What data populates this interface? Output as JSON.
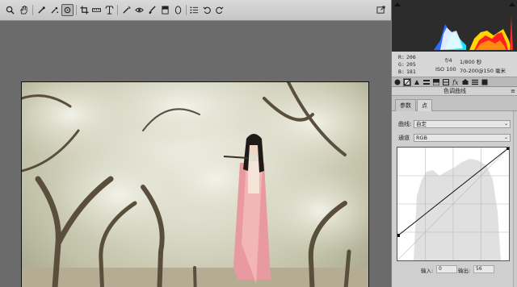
{
  "toolbar": {
    "tools": [
      {
        "name": "zoom-tool"
      },
      {
        "name": "hand-tool"
      },
      {
        "name": "white-balance-tool"
      },
      {
        "name": "color-sampler-tool"
      },
      {
        "name": "targeted-adjustment-tool"
      },
      {
        "name": "crop-tool"
      },
      {
        "name": "straighten-tool"
      },
      {
        "name": "transform-tool"
      },
      {
        "name": "spot-removal-tool"
      },
      {
        "name": "red-eye-tool"
      },
      {
        "name": "adjustment-brush-tool"
      },
      {
        "name": "graduated-filter-tool"
      },
      {
        "name": "radial-filter-tool"
      },
      {
        "name": "preferences-tool"
      },
      {
        "name": "rotate-ccw-tool"
      },
      {
        "name": "rotate-cw-tool"
      }
    ],
    "active_tool": "targeted-adjustment-tool"
  },
  "info": {
    "r_label": "R:",
    "r_value": "206",
    "g_label": "G:",
    "g_value": "205",
    "b_label": "B:",
    "b_value": "181",
    "aperture": "f/4",
    "shutter": "1/800 秒",
    "iso": "ISO 100",
    "lens": "70-200@150 毫米"
  },
  "panel": {
    "title": "色调曲线",
    "tabs": [
      {
        "label": "参数"
      },
      {
        "label": "点"
      }
    ],
    "active_tab": 1,
    "curve_label": "曲线:",
    "curve_value": "自定",
    "channel_label": "通道",
    "channel_value": "RGB",
    "input_label": "输入:",
    "input_value": "0",
    "output_label": "输出:",
    "output_value": "56"
  },
  "colors": {
    "toolbar_bg": "#cdcdcd",
    "viewport_bg": "#6b6b6b",
    "panel_bg": "#cfcfcf",
    "histogram_bg": "#2c2c2c"
  }
}
